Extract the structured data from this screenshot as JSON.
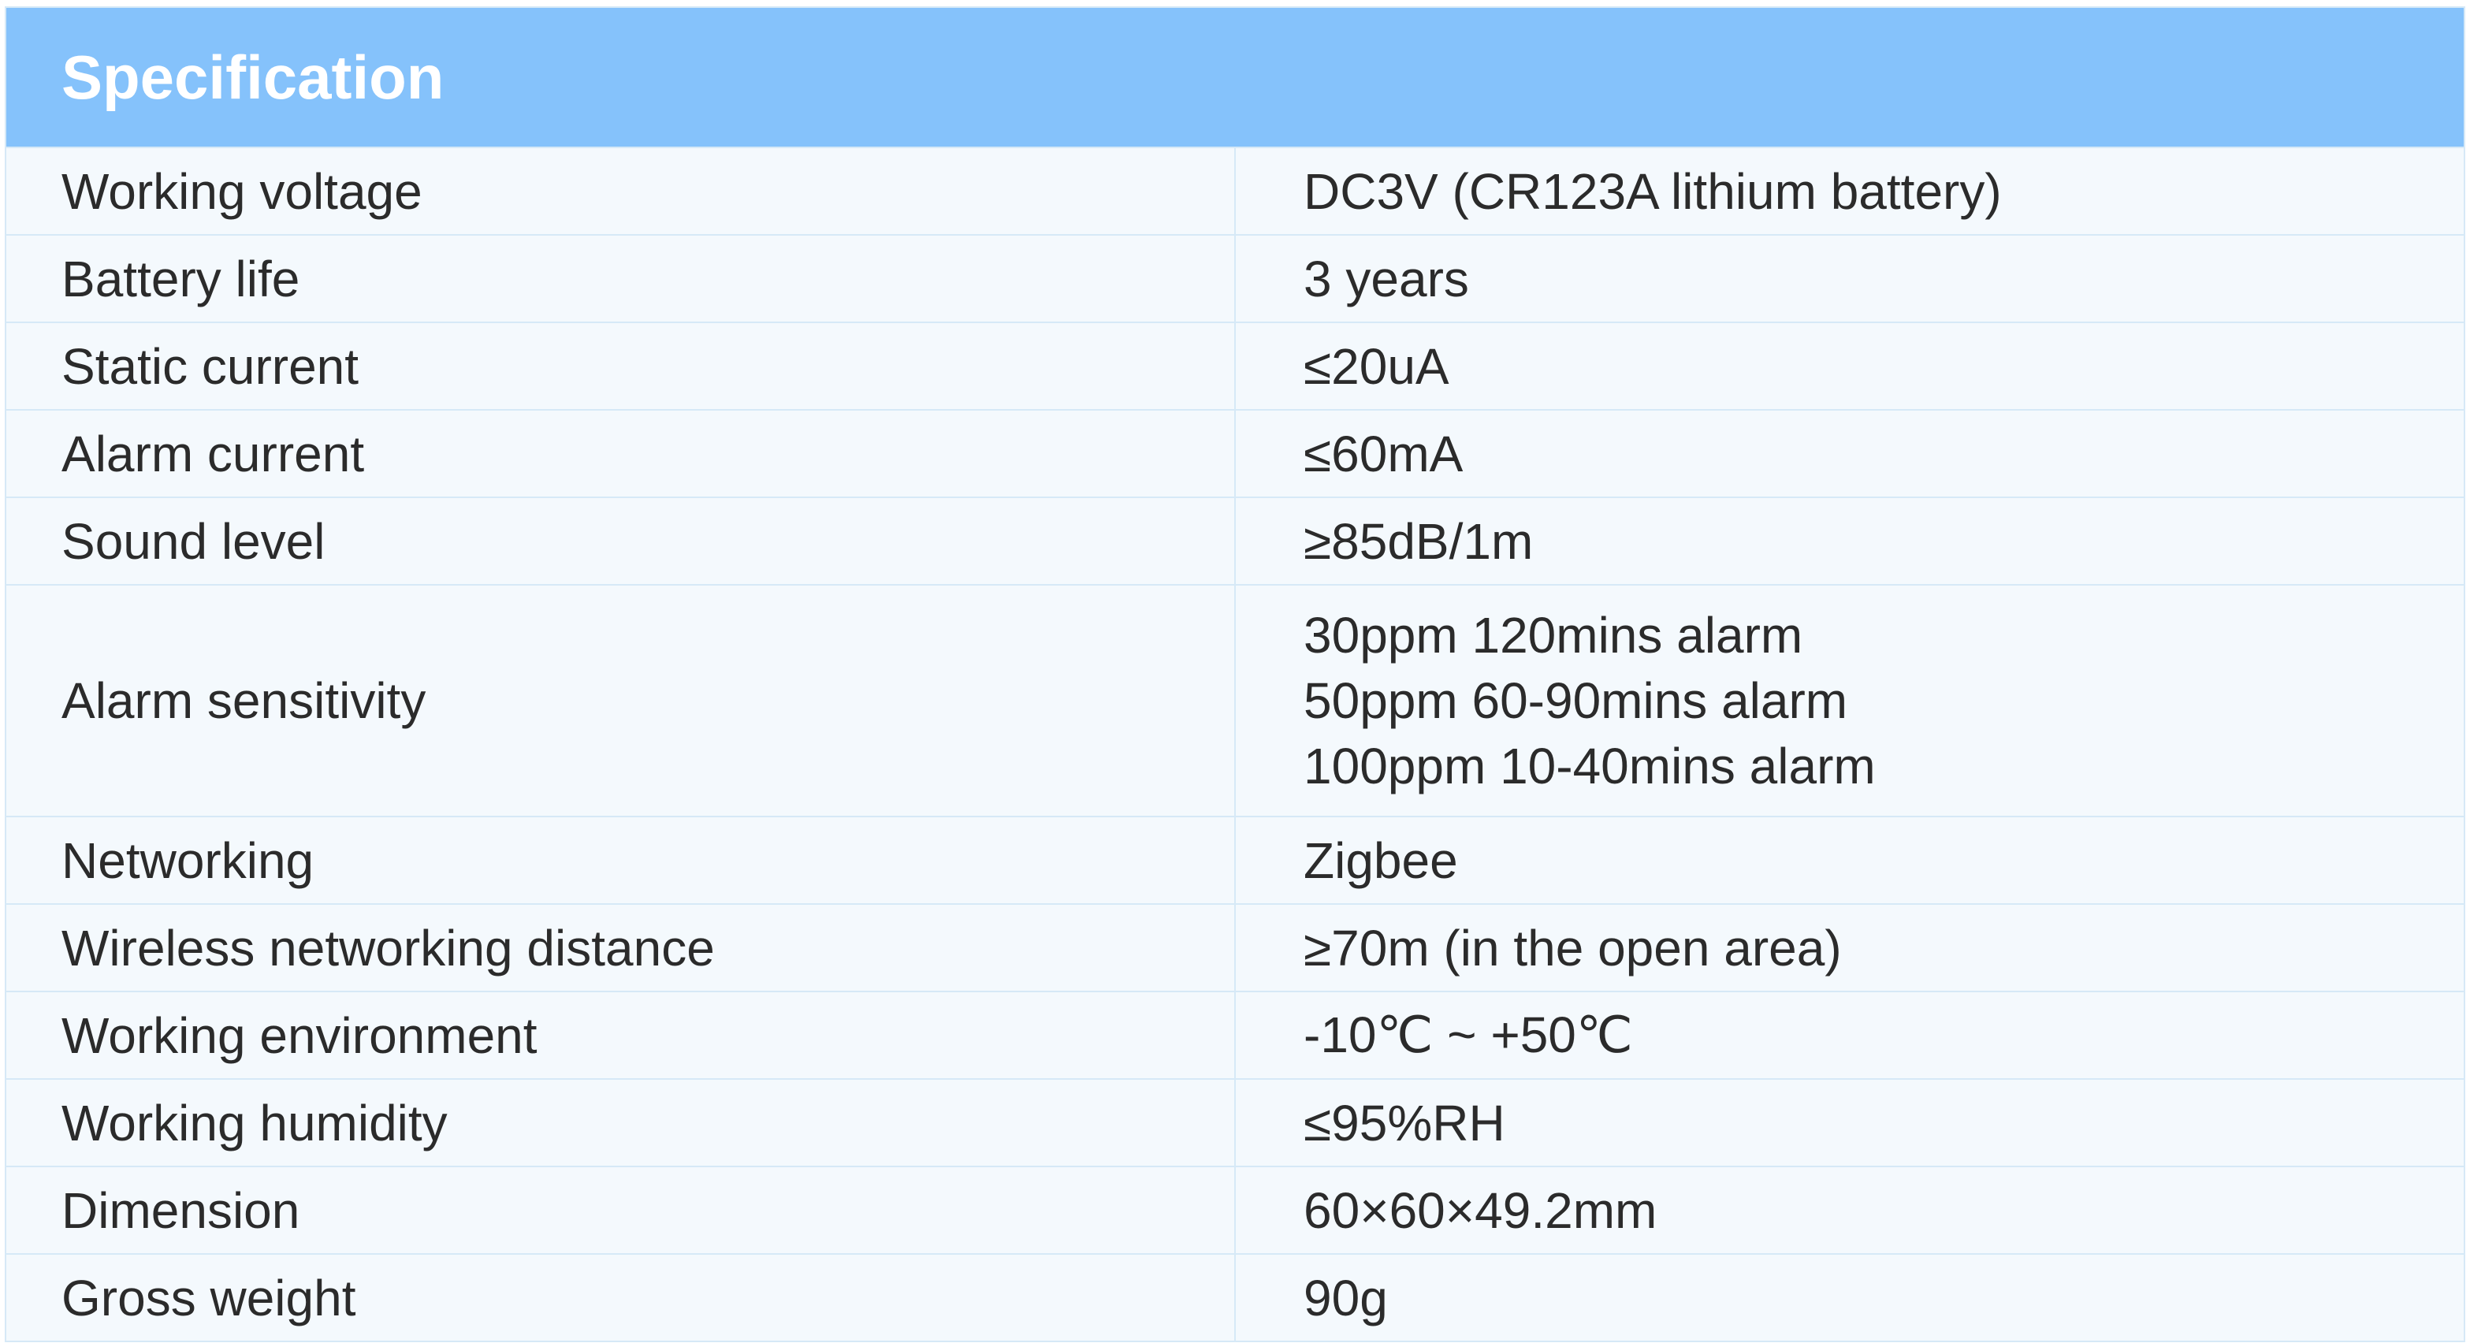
{
  "table": {
    "header": "Specification",
    "rows": [
      {
        "label": "Working voltage",
        "value": "DC3V (CR123A lithium battery)"
      },
      {
        "label": "Battery life",
        "value": "3 years"
      },
      {
        "label": "Static current",
        "value": "≤20uA"
      },
      {
        "label": "Alarm current",
        "value": "≤60mA"
      },
      {
        "label": "Sound level",
        "value": "≥85dB/1m"
      },
      {
        "label": "Alarm sensitivity",
        "value_lines": [
          "30ppm 120mins alarm",
          "50ppm 60-90mins alarm",
          "100ppm 10-40mins alarm"
        ]
      },
      {
        "label": "Networking",
        "value": "Zigbee"
      },
      {
        "label": "Wireless networking distance",
        "value": "≥70m (in the open area)"
      },
      {
        "label": "Working environment",
        "value": "-10℃ ~ +50℃"
      },
      {
        "label": "Working humidity",
        "value": "≤95%RH"
      },
      {
        "label": "Dimension",
        "value": "60×60×49.2mm"
      },
      {
        "label": "Gross weight",
        "value": "90g"
      }
    ]
  },
  "colors": {
    "header_background": "#85c2fb",
    "header_text": "#ffffff",
    "row_background": "#f4f9fd",
    "border": "#d6e9f7",
    "text": "#2b2b2b"
  }
}
